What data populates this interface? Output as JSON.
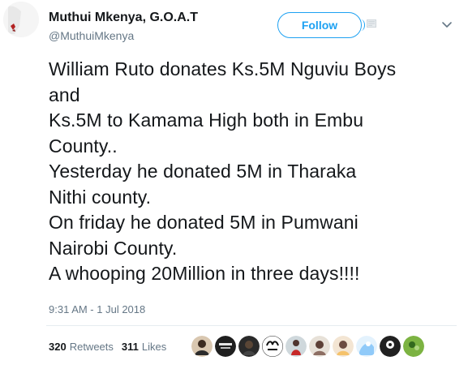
{
  "author": {
    "display_name": "Muthui Mkenya, G.O.A.T",
    "screen_name": "@MuthuiMkenya",
    "avatar_icon": "default-egg-avatar"
  },
  "follow_label": "Follow",
  "tweet": {
    "lines": [
      "William Ruto donates Ks.5M Nguviu Boys",
      "and",
      "Ks.5M to Kamama High both in Embu",
      "County..",
      "Yesterday he donated 5M in Tharaka",
      "Nithi county.",
      "On friday he donated 5M in Pumwani",
      "Nairobi County.",
      "A whooping 20Million in three days!!!!"
    ],
    "timestamp": "9:31 AM - 1 Jul 2018"
  },
  "stats": {
    "retweets": {
      "count": "320",
      "label": "Retweets"
    },
    "likes": {
      "count": "311",
      "label": "Likes"
    }
  },
  "colors": {
    "accent": "#1da1f2",
    "text": "#14171a",
    "secondary": "#657786",
    "divider": "#e6ecf0"
  },
  "likers": [
    {
      "icon": "liker-avatar-1"
    },
    {
      "icon": "liker-avatar-2"
    },
    {
      "icon": "liker-avatar-3"
    },
    {
      "icon": "liker-avatar-4"
    },
    {
      "icon": "liker-avatar-5"
    },
    {
      "icon": "liker-avatar-6"
    },
    {
      "icon": "liker-avatar-7"
    },
    {
      "icon": "liker-avatar-8"
    },
    {
      "icon": "liker-avatar-9"
    },
    {
      "icon": "liker-avatar-10"
    }
  ]
}
